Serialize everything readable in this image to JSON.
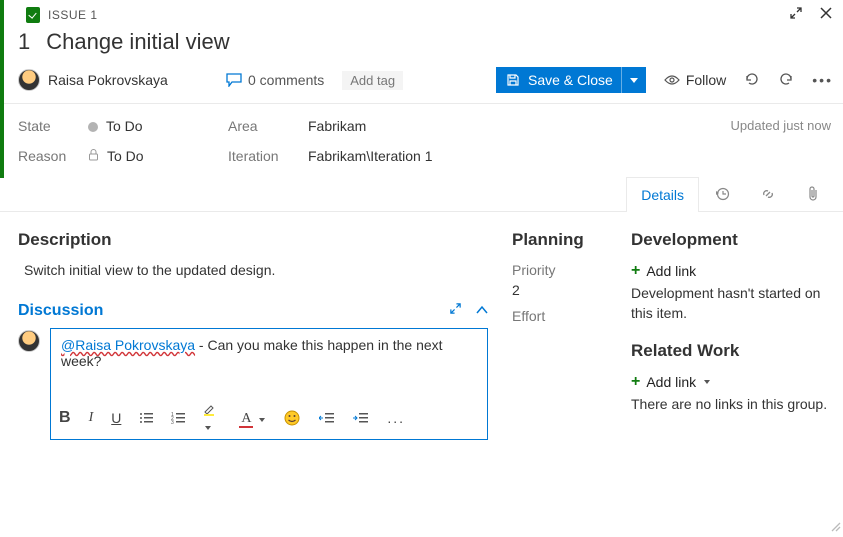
{
  "header": {
    "issue_label": "ISSUE 1",
    "id": "1",
    "title": "Change initial view",
    "assignee": "Raisa Pokrovskaya",
    "comments_label": "0 comments",
    "add_tag_label": "Add tag",
    "save_label": "Save & Close",
    "follow_label": "Follow",
    "updated_label": "Updated just now"
  },
  "meta": {
    "state_label": "State",
    "state_value": "To Do",
    "reason_label": "Reason",
    "reason_value": "To Do",
    "area_label": "Area",
    "area_value": "Fabrikam",
    "iteration_label": "Iteration",
    "iteration_value": "Fabrikam\\Iteration 1"
  },
  "tabs": {
    "details": "Details"
  },
  "description": {
    "heading": "Description",
    "text": "Switch initial view to the updated design."
  },
  "discussion": {
    "heading": "Discussion",
    "mention": "@Raisa Pokrovskaya",
    "text": " - Can you make this happen in the next week?"
  },
  "planning": {
    "heading": "Planning",
    "priority_label": "Priority",
    "priority_value": "2",
    "effort_label": "Effort"
  },
  "development": {
    "heading": "Development",
    "add_link": "Add link",
    "empty": "Development hasn't started on this item."
  },
  "related": {
    "heading": "Related Work",
    "add_link": "Add link",
    "empty": "There are no links in this group."
  }
}
